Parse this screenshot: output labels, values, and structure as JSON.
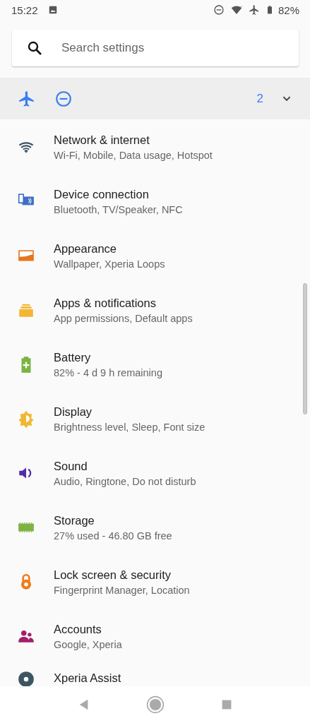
{
  "status_bar": {
    "time": "15:22",
    "battery_text": "82%"
  },
  "search": {
    "placeholder": "Search settings"
  },
  "conditions": {
    "count": "2",
    "expanded": false
  },
  "items": [
    {
      "title": "Network & internet",
      "subtitle": "Wi-Fi, Mobile, Data usage, Hotspot"
    },
    {
      "title": "Device connection",
      "subtitle": "Bluetooth, TV/Speaker, NFC"
    },
    {
      "title": "Appearance",
      "subtitle": "Wallpaper, Xperia Loops"
    },
    {
      "title": "Apps & notifications",
      "subtitle": "App permissions, Default apps"
    },
    {
      "title": "Battery",
      "subtitle": "82% - 4 d 9 h remaining"
    },
    {
      "title": "Display",
      "subtitle": "Brightness level, Sleep, Font size"
    },
    {
      "title": "Sound",
      "subtitle": "Audio, Ringtone, Do not disturb"
    },
    {
      "title": "Storage",
      "subtitle": "27% used - 46.80 GB free"
    },
    {
      "title": "Lock screen & security",
      "subtitle": "Fingerprint Manager, Location"
    },
    {
      "title": "Accounts",
      "subtitle": "Google, Xperia"
    },
    {
      "title": "Xperia Assist"
    }
  ]
}
